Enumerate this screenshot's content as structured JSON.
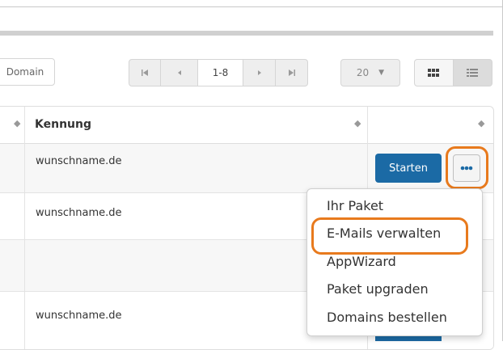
{
  "toolbar": {
    "domain_button": "Domain",
    "pager": {
      "range": "1-8"
    },
    "per_page": "20"
  },
  "table": {
    "columns": [
      "Kennung"
    ],
    "rows": [
      {
        "kennung": "wunschname.de",
        "start_label": "Starten"
      },
      {
        "kennung": "wunschname.de"
      },
      {
        "kennung": ""
      },
      {
        "kennung": "wunschname.de"
      }
    ]
  },
  "menu": {
    "items": [
      "Ihr Paket",
      "E-Mails verwalten",
      "AppWizard",
      "Paket upgraden",
      "Domains bestellen"
    ]
  },
  "colors": {
    "accent": "#1b6aa5",
    "highlight": "#e87a1d"
  }
}
